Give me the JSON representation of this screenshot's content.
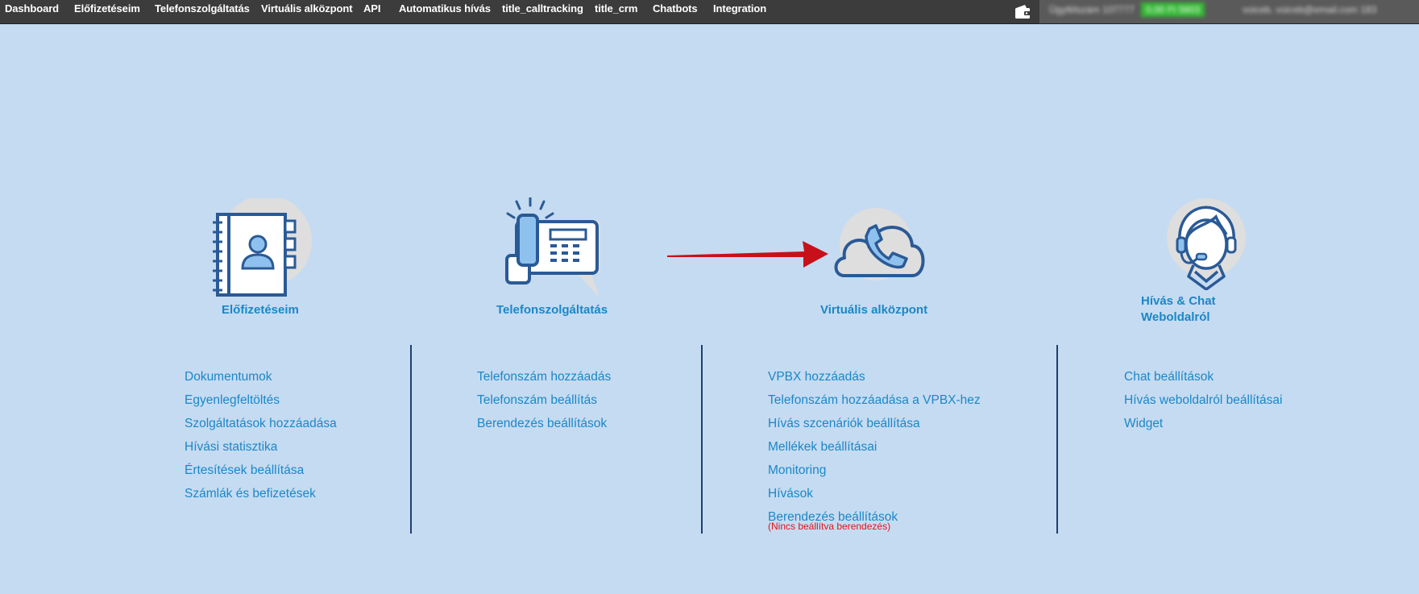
{
  "topnav": {
    "items": [
      "Dashboard",
      "Előfizetéseim",
      "Telefonszolgáltatás",
      "Virtuális alközpont",
      "API",
      "Automatikus hívás",
      "title_calltracking",
      "title_crm",
      "Chatbots",
      "Integration"
    ]
  },
  "icons": {
    "wallet": "wallet-icon",
    "contacts": "address-book-icon",
    "phone": "desk-phone-icon",
    "cloud": "cloud-phone-icon",
    "agent": "headset-agent-icon",
    "arrow": "red-arrow-icon"
  },
  "colors": {
    "background": "#c5dbf1",
    "link": "#1b87c8",
    "icon_stroke": "#2a5a96",
    "warning": "#e0141c",
    "arrow": "#c8101a"
  },
  "sections": {
    "subscriptions": {
      "title": "Előfizetéseim",
      "links": [
        "Dokumentumok",
        "Egyenlegfeltöltés",
        "Szolgáltatások hozzáadása",
        "Hívási statisztika",
        "Értesítések beállítása",
        "Számlák és befizetések"
      ]
    },
    "telephony": {
      "title": "Telefonszolgáltatás",
      "links": [
        "Telefonszám hozzáadás",
        "Telefonszám beállítás",
        "Berendezés beállítások"
      ]
    },
    "vpbx": {
      "title": "Virtuális alközpont",
      "links": [
        "VPBX hozzáadás",
        "Telefonszám hozzáadása a VPBX-hez",
        "Hívás szcenáriók beállítása",
        "Mellékek beállításai",
        "Monitoring",
        "Hívások",
        "Berendezés beállítások"
      ],
      "warning": "(Nincs beállítva berendezés)"
    },
    "chat": {
      "title_line1": "Hívás & Chat",
      "title_line2": "Weboldalról",
      "links": [
        "Chat beállítások",
        "Hívás weboldalról beállításai",
        "Widget"
      ]
    }
  }
}
